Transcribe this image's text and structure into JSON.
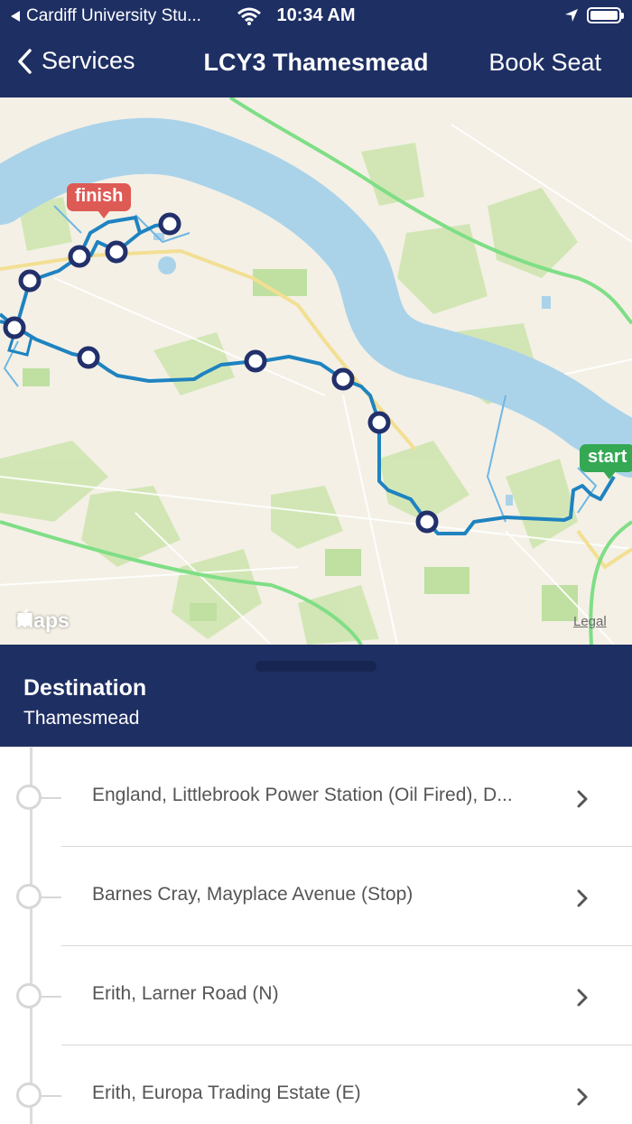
{
  "status_bar": {
    "carrier": "Cardiff University Stu...",
    "time": "10:34 AM"
  },
  "nav": {
    "back_label": "Services",
    "title": "LCY3 Thamesmead",
    "action_label": "Book Seat"
  },
  "map": {
    "brand": "Maps",
    "legal": "Legal",
    "finish_label": "finish",
    "start_label": "start",
    "icons": [
      "apple-icon"
    ],
    "colors": {
      "water": "#aad3ea",
      "route": "#1f83c0",
      "stop_marker": "#22306b",
      "major_road": "#7fde86",
      "finish_tag": "#de5a55",
      "start_tag": "#34a853"
    }
  },
  "destination": {
    "label": "Destination",
    "value": "Thamesmead"
  },
  "stops": [
    {
      "name": "England, Littlebrook Power Station (Oil Fired), D..."
    },
    {
      "name": "Barnes Cray, Mayplace Avenue (Stop)"
    },
    {
      "name": "Erith, Larner Road (N)"
    },
    {
      "name": "Erith, Europa Trading Estate (E)"
    }
  ],
  "theme": {
    "header_bg": "#1e2f63"
  }
}
